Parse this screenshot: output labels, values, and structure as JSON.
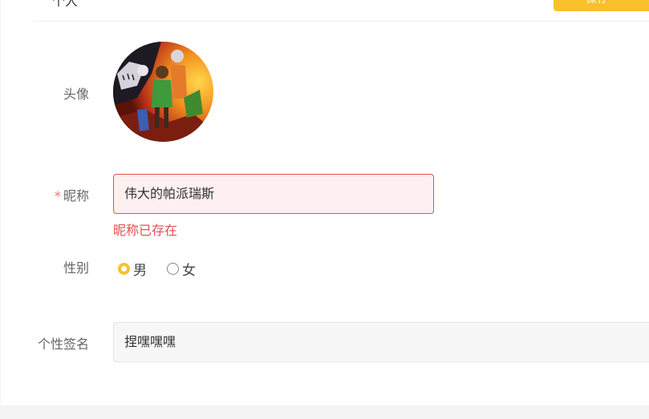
{
  "header": {
    "title": "个人",
    "save_label": "保存"
  },
  "form": {
    "avatar_label": "头像",
    "nickname_label": "昵称",
    "nickname_required_mark": "*",
    "nickname_value": "伟大的帕派瑞斯",
    "nickname_error": "昵称已存在",
    "gender_label": "性别",
    "gender_options": [
      {
        "label": "男",
        "checked": true
      },
      {
        "label": "女",
        "checked": false
      }
    ],
    "signature_label": "个性签名",
    "signature_value": "捏嘿嘿嘿"
  },
  "colors": {
    "accent": "#f8c12b",
    "error": "#e55050",
    "error_bg": "#fef0f0"
  }
}
